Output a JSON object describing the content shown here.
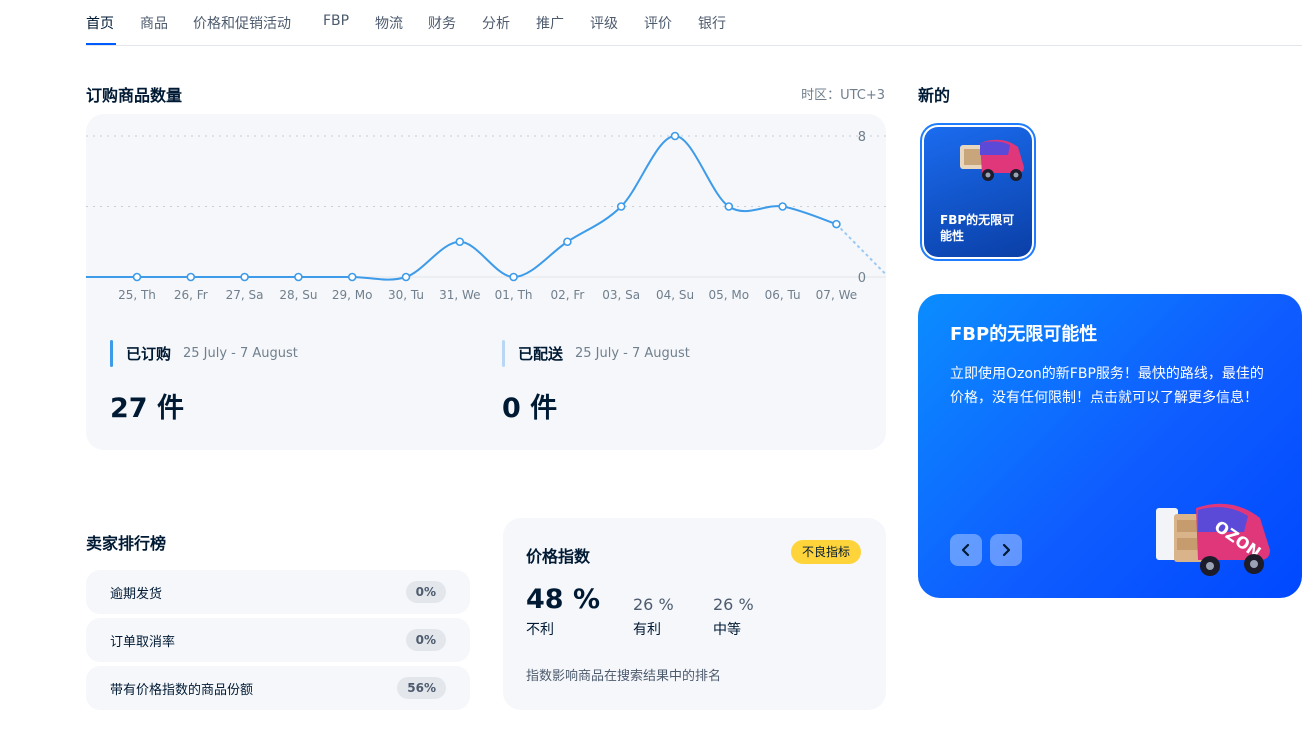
{
  "nav": {
    "tabs": [
      {
        "label": "首页",
        "active": true
      },
      {
        "label": "商品"
      },
      {
        "label": "价格和促销活动"
      },
      {
        "label": "FBP"
      },
      {
        "label": "物流"
      },
      {
        "label": "财务"
      },
      {
        "label": "分析"
      },
      {
        "label": "推广"
      },
      {
        "label": "评级"
      },
      {
        "label": "评价"
      },
      {
        "label": "银行"
      }
    ]
  },
  "orders": {
    "title": "订购商品数量",
    "timezone": "时区：UTC+3",
    "ordered": {
      "label": "已订购",
      "range": "25 July - 7 August",
      "value": "27 件"
    },
    "shipped": {
      "label": "已配送",
      "range": "25 July - 7 August",
      "value": "0 件"
    }
  },
  "chart_data": {
    "type": "line",
    "categories": [
      "25, Th",
      "26, Fr",
      "27, Sa",
      "28, Su",
      "29, Mo",
      "30, Tu",
      "31, We",
      "01, Th",
      "02, Fr",
      "03, Sa",
      "04, Su",
      "05, Mo",
      "06, Tu",
      "07, We"
    ],
    "series": [
      {
        "values": [
          0,
          0,
          0,
          0,
          0,
          0,
          2,
          0,
          2,
          4,
          8,
          4,
          4,
          3
        ]
      }
    ],
    "ylim": [
      0,
      8
    ],
    "y_ticks": [
      "0",
      "8"
    ],
    "grid": true,
    "line_color": "#3d9be9"
  },
  "ranking": {
    "title": "卖家排行榜",
    "rows": [
      {
        "label": "逾期发货",
        "value": "0%"
      },
      {
        "label": "订单取消率",
        "value": "0%"
      },
      {
        "label": "带有价格指数的商品份额",
        "value": "56%"
      }
    ]
  },
  "price_index": {
    "title": "价格指数",
    "badge": "不良指标",
    "main_value": "48 %",
    "main_label": "不利",
    "items": [
      {
        "value": "26 %",
        "label": "有利"
      },
      {
        "value": "26 %",
        "label": "中等"
      }
    ],
    "note": "指数影响商品在搜索结果中的排名"
  },
  "news": {
    "title": "新的",
    "story_text": "FBP的无限可能性"
  },
  "promo": {
    "title": "FBP的无限可能性",
    "body": "立即使用Ozon的新FBP服务！最快的路线，最佳的价格，没有任何限制！点击就可以了解更多信息！",
    "van_label": "OZON"
  },
  "colors": {
    "accent": "#005bff",
    "badge_warning": "#ffd43b",
    "ordered_bar": "#3d9be9",
    "shipped_bar": "#b9d7f4"
  }
}
